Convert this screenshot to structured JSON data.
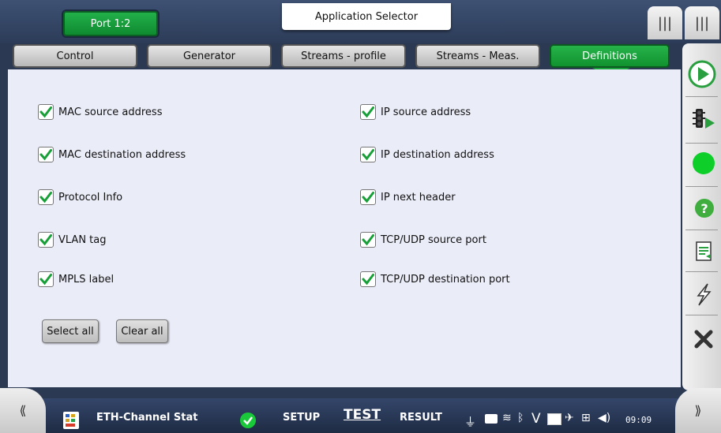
{
  "topbar": {
    "port_label": "Port 1:2",
    "app_selector_label": "Application Selector",
    "menu_icon": "|||"
  },
  "tabs": [
    {
      "label": "Control",
      "active": false
    },
    {
      "label": "Generator",
      "active": false
    },
    {
      "label": "Streams - profile",
      "active": false
    },
    {
      "label": "Streams - Meas.",
      "active": false
    },
    {
      "label": "Definitions",
      "active": true
    }
  ],
  "left_column": [
    {
      "label": "MAC source address",
      "checked": true
    },
    {
      "label": "MAC destination address",
      "checked": true
    },
    {
      "label": "Protocol Info",
      "checked": true
    },
    {
      "label": "VLAN tag",
      "checked": true
    },
    {
      "label": "MPLS label",
      "checked": true
    }
  ],
  "right_column": [
    {
      "label": "IP source address",
      "checked": true
    },
    {
      "label": "IP destination address",
      "checked": true
    },
    {
      "label": "IP next header",
      "checked": true
    },
    {
      "label": "TCP/UDP source port",
      "checked": true
    },
    {
      "label": "TCP/UDP destination port",
      "checked": true
    }
  ],
  "buttons": {
    "select_all": "Select all",
    "clear_all": "Clear all"
  },
  "sidebar": [
    "play-icon",
    "traffic-light-icon",
    "status-led-icon",
    "help-icon",
    "report-icon",
    "lightning-icon",
    "close-icon"
  ],
  "bottombar": {
    "left_arrows": "⟪",
    "right_arrows": "⟫",
    "app_name": "ETH-Channel Stat",
    "setup": "SETUP",
    "test": "TEST",
    "result": "RESULT",
    "time": "09:09"
  },
  "colors": {
    "accent_green": "#1aa33d",
    "panel_bg": "#eaecf8",
    "frame": "#2b3a52"
  }
}
